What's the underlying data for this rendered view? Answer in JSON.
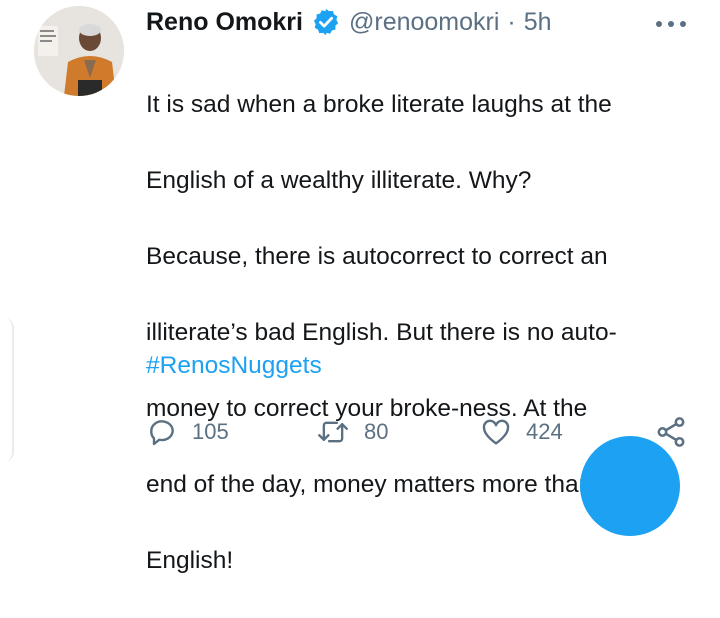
{
  "tweet": {
    "author_name": "Reno Omokri",
    "handle": "@renoomokri",
    "separator": "·",
    "time": "5h",
    "text_lines": [
      "It is sad when a broke literate laughs at the",
      "English of a wealthy illiterate. Why?",
      "Because, there is autocorrect to correct an",
      "illiterate’s bad English. But there is no auto-",
      "money to correct your broke-ness. At the",
      "end of the day, money matters more than",
      "English!"
    ],
    "hashtag": "#RenosNuggets"
  },
  "actions": {
    "reply_count": "105",
    "retweet_count": "80",
    "like_count": "424"
  },
  "icons": {
    "verified": "verified-badge-icon",
    "more": "more-options-icon",
    "reply": "reply-icon",
    "retweet": "retweet-icon",
    "like": "heart-icon",
    "share": "share-icon"
  },
  "colors": {
    "accent": "#1da1f2",
    "text": "#14171a",
    "secondary": "#5b7083"
  }
}
